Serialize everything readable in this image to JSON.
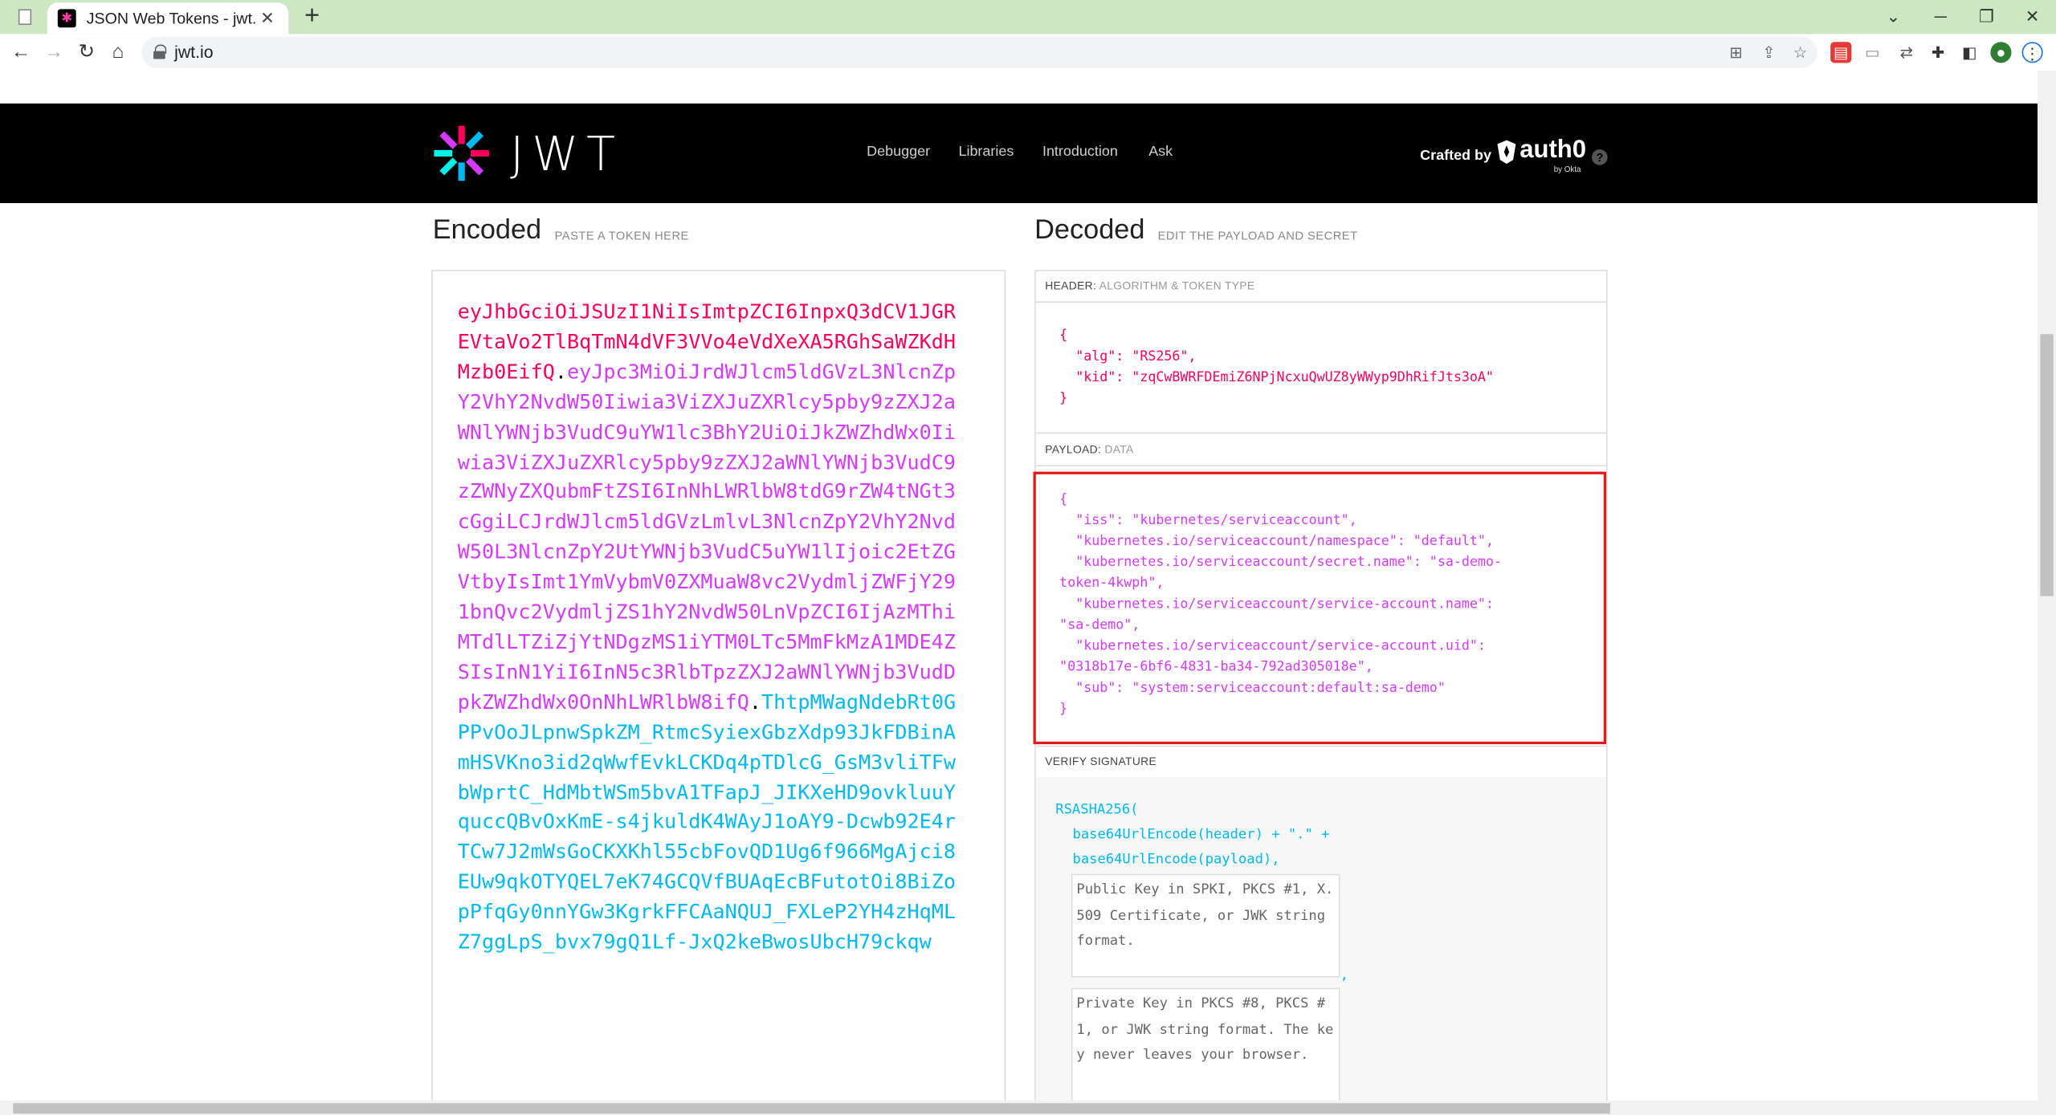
{
  "browser": {
    "tab_title": "JSON Web Tokens - jwt.io",
    "url": "jwt.io"
  },
  "site": {
    "logo": "JWT",
    "nav": [
      "Debugger",
      "Libraries",
      "Introduction",
      "Ask"
    ],
    "crafted_by": "Crafted by",
    "brand": "auth0",
    "brand_sub": "by Okta"
  },
  "encoded": {
    "title": "Encoded",
    "subtitle": "PASTE A TOKEN HERE",
    "header_part": "eyJhbGciOiJSUzI1NiIsImtpZCI6InpxQ3dCV1JGREVtaVo2TlBqTmN4dVF3VVo4eVdXeXA5RGhSaWZKdHMzb0EifQ",
    "payload_part": "eyJpc3MiOiJrdWJlcm5ldGVzL3NlcnZpY2VhY2NvdW50Iiwia3ViZXJuZXRlcy5pby9zZXJ2aWNlYWNjb3VudC9uYW1lc3BhY2UiOiJkZWZhdWx0Iiwia3ViZXJuZXRlcy5pby9zZXJ2aWNlYWNjb3VudC9zZWNyZXQubmFtZSI6InNhLWRlbW8tdG9rZW4tNGt3cGgiLCJrdWJlcm5ldGVzLmlvL3NlcnZpY2VhY2NvdW50L3NlcnZpY2UtYWNjb3VudC5uYW1lIjoic2EtZGVtbyIsImt1YmVybmV0ZXMuaW8vc2VydmljZWFjY291bnQvc2VydmljZS1hY2NvdW50LnVpZCI6IjAzMThiMTdlLTZiZjYtNDgzMS1iYTM0LTc5MmFkMzA1MDE4ZSIsInN1YiI6InN5c3RlbTpzZXJ2aWNlYWNjb3VudDpkZWZhdWx0OnNhLWRlbW8ifQ",
    "signature_part": "ThtpMWagNdebRt0GPPvOoJLpnwSpkZM_RtmcSyiexGbzXdp93JkFDBinAmHSVKno3id2qWwfEvkLCKDq4pTDlcG_GsM3vliTFwbWprtC_HdMbtWSm5bvA1TFapJ_JIKXeHD9ovkluuYquccQBvOxKmE-s4jkuldK4WAyJ1oAY9-Dcwb92E4rTCw7J2mWsGoCKXKhl55cbFovQD1Ug6f966MgAjci8EUw9qkOTYQEL7eK74GCQVfBUAqEcBFutotOi8BiZopPfqGy0nnYGw3KgrkFFCAaNQUJ_FXLeP2YH4zHqMLZ7ggLpS_bvx79gQ1Lf-JxQ2keBwosUbcH79ckqw"
  },
  "decoded": {
    "title": "Decoded",
    "subtitle": "EDIT THE PAYLOAD AND SECRET",
    "header_label": "HEADER:",
    "header_sub": "ALGORITHM & TOKEN TYPE",
    "header_json": "{\n  \"alg\": \"RS256\",\n  \"kid\": \"zqCwBWRFDEmiZ6NPjNcxuQwUZ8yWWyp9DhRifJts3oA\"\n}",
    "payload_label": "PAYLOAD:",
    "payload_sub": "DATA",
    "payload_json": "{\n  \"iss\": \"kubernetes/serviceaccount\",\n  \"kubernetes.io/serviceaccount/namespace\": \"default\",\n  \"kubernetes.io/serviceaccount/secret.name\": \"sa-demo-\ntoken-4kwph\",\n  \"kubernetes.io/serviceaccount/service-account.name\":\n\"sa-demo\",\n  \"kubernetes.io/serviceaccount/service-account.uid\":\n\"0318b17e-6bf6-4831-ba34-792ad305018e\",\n  \"sub\": \"system:serviceaccount:default:sa-demo\"\n}",
    "verify_label": "VERIFY SIGNATURE",
    "sig_line1": "RSASHA256(",
    "sig_line2": "base64UrlEncode(header) + \".\" +",
    "sig_line3": "base64UrlEncode(payload),",
    "sig_comma": ",",
    "public_key_placeholder": "Public Key in SPKI, PKCS #1, X.509 Certificate, or JWK string format.",
    "private_key_placeholder": "Private Key in PKCS #8, PKCS #1, or JWK string format. The key never leaves your browser."
  }
}
